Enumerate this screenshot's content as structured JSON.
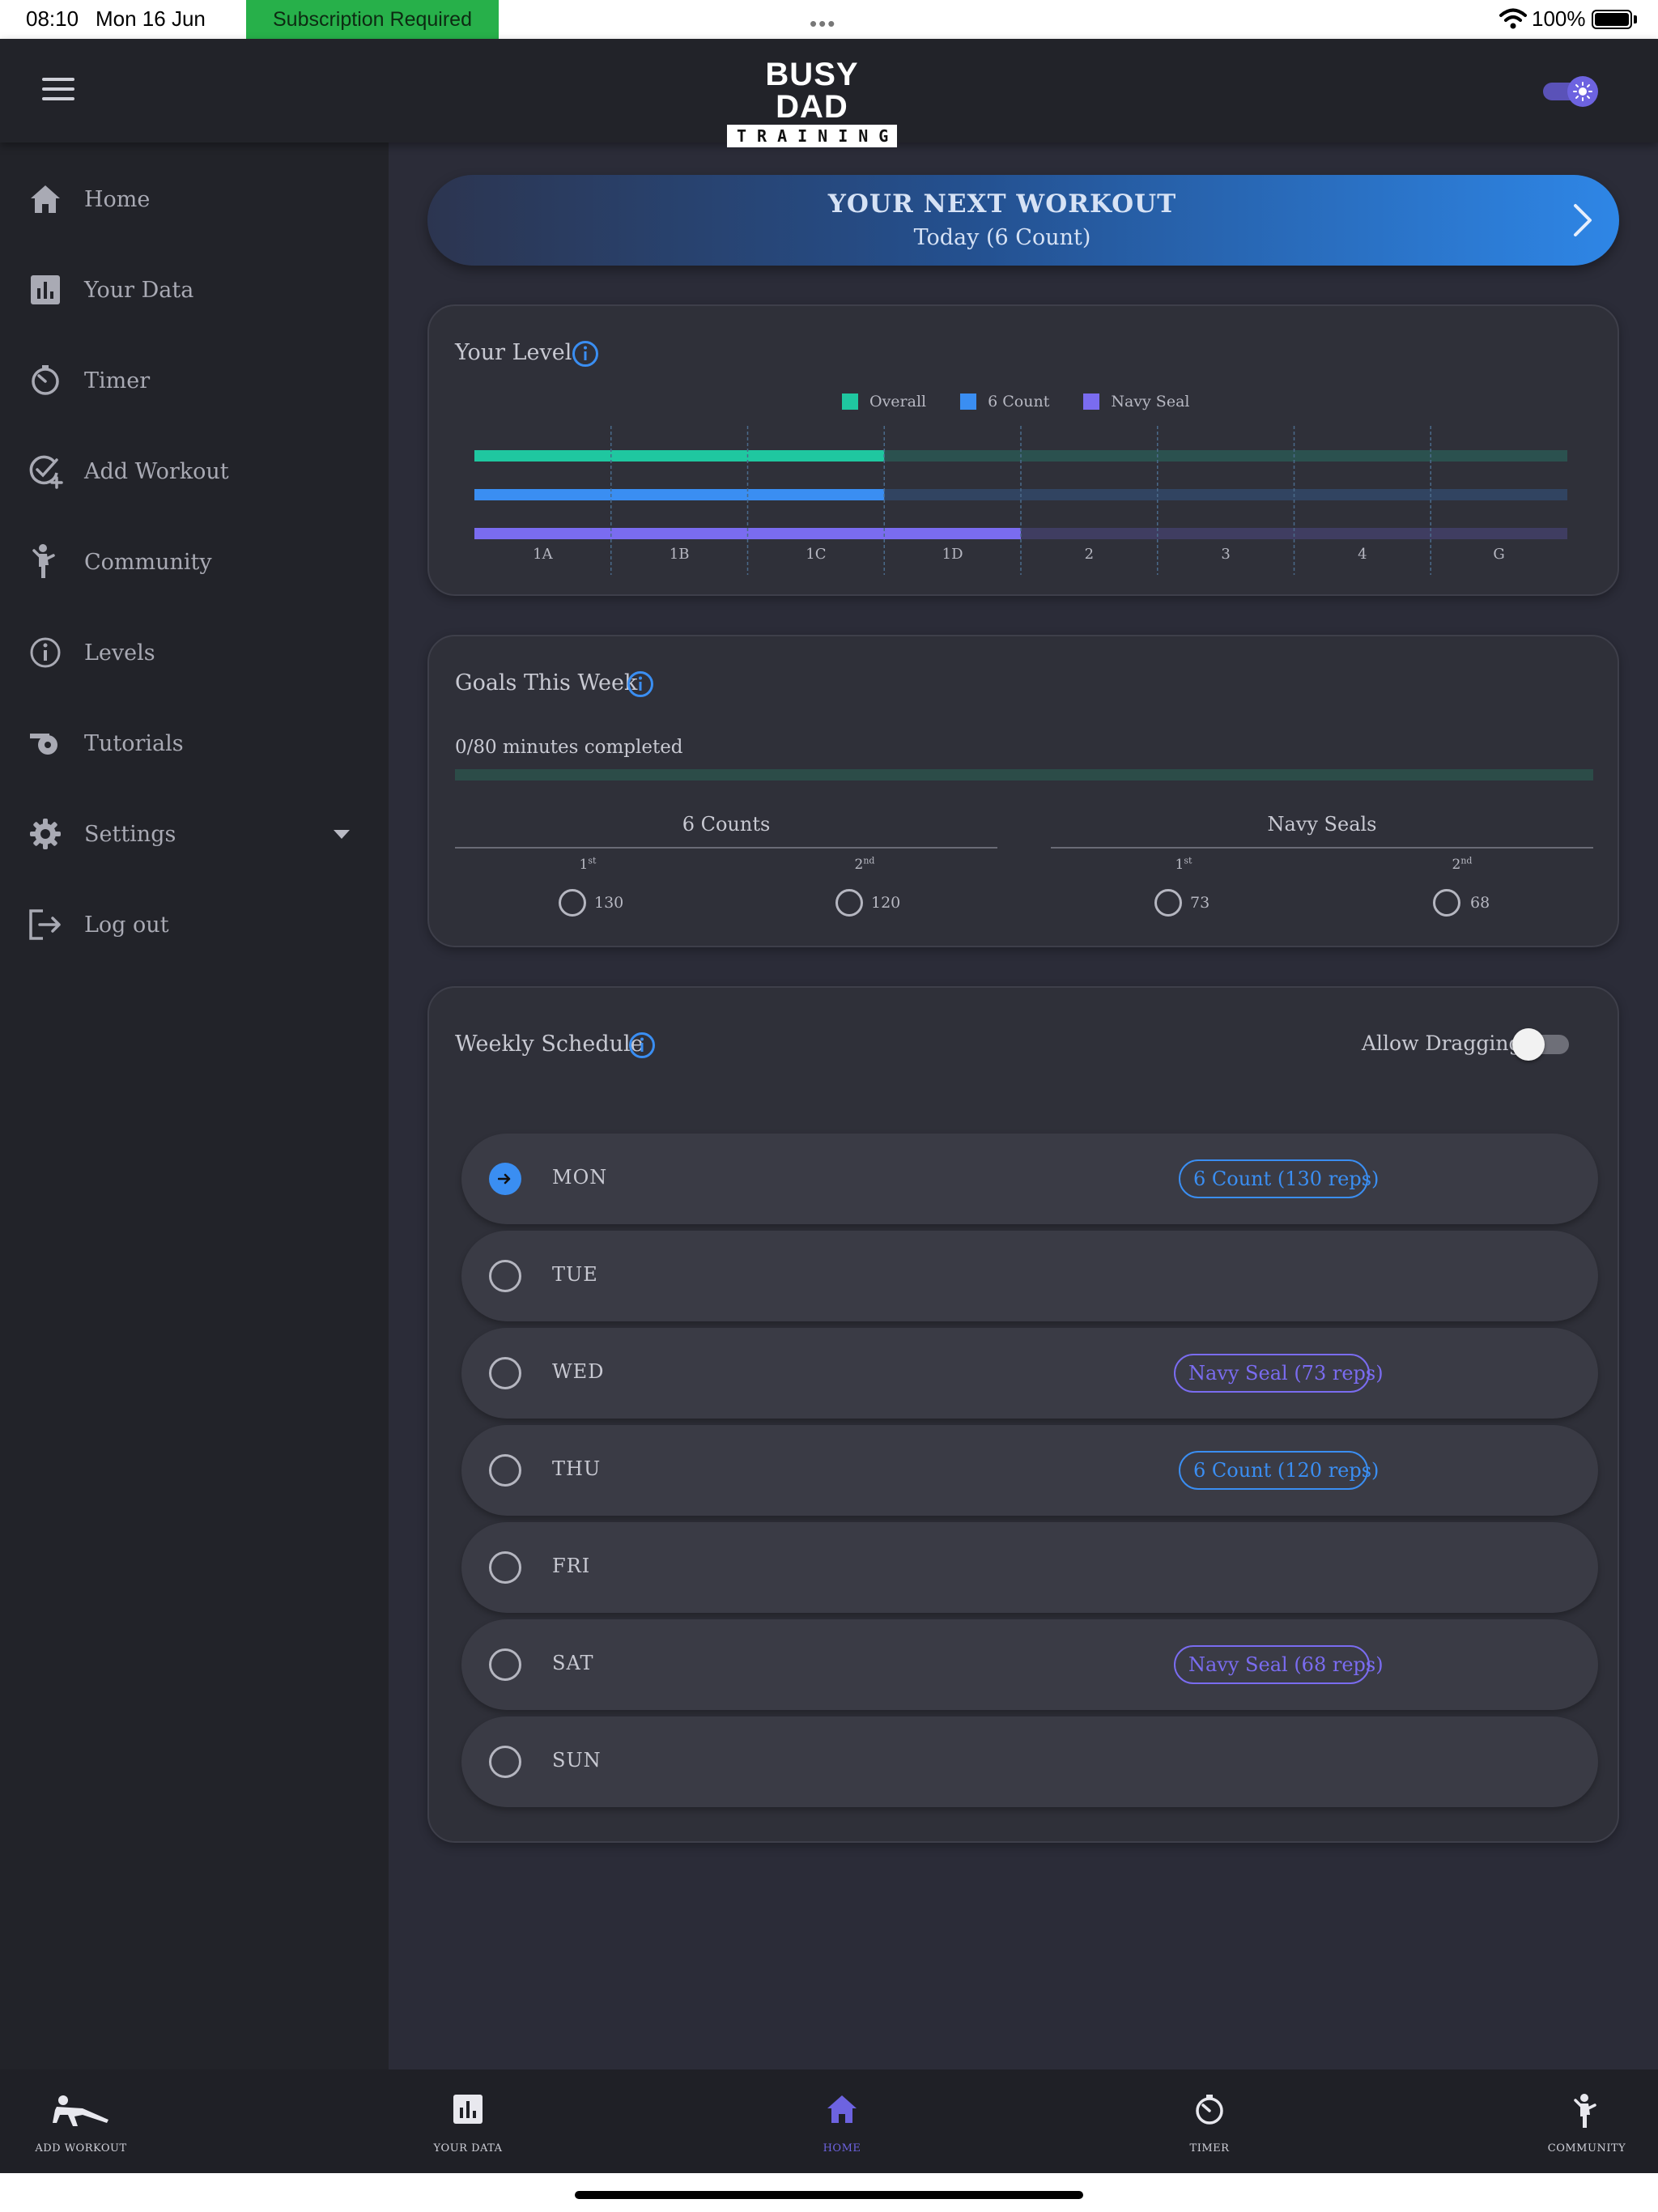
{
  "status_bar": {
    "time": "08:10",
    "date": "Mon 16 Jun",
    "subscription_banner": "Subscription Required",
    "more": "•••",
    "battery": "100%"
  },
  "header": {
    "logo_top": "BUSY DAD",
    "logo_bottom": "TRAINING",
    "theme_toggle": "on"
  },
  "sidebar": {
    "items": [
      {
        "label": "Home",
        "icon": "home-icon"
      },
      {
        "label": "Your Data",
        "icon": "bar-chart-icon"
      },
      {
        "label": "Timer",
        "icon": "timer-icon"
      },
      {
        "label": "Add Workout",
        "icon": "add-workout-icon"
      },
      {
        "label": "Community",
        "icon": "community-icon"
      },
      {
        "label": "Levels",
        "icon": "info-icon"
      },
      {
        "label": "Tutorials",
        "icon": "whistle-icon"
      },
      {
        "label": "Settings",
        "icon": "gear-icon"
      },
      {
        "label": "Log out",
        "icon": "logout-icon"
      }
    ]
  },
  "next_workout": {
    "title": "YOUR NEXT WORKOUT",
    "subtitle": "Today (6 Count)"
  },
  "level_card": {
    "title": "Your Level"
  },
  "goals_card": {
    "title": "Goals This Week",
    "progress_text": "0/80 minutes completed",
    "progress_fraction": 0,
    "groups": [
      {
        "title": "6 Counts",
        "items": [
          {
            "ordinal": "1",
            "suffix": "st",
            "value": "130"
          },
          {
            "ordinal": "2",
            "suffix": "nd",
            "value": "120"
          }
        ]
      },
      {
        "title": "Navy Seals",
        "items": [
          {
            "ordinal": "1",
            "suffix": "st",
            "value": "73"
          },
          {
            "ordinal": "2",
            "suffix": "nd",
            "value": "68"
          }
        ]
      }
    ]
  },
  "schedule_card": {
    "title": "Weekly Schedule",
    "drag_label": "Allow Dragging",
    "drag_enabled": false,
    "days": [
      {
        "day": "MON",
        "active": true,
        "chip": "6 Count (130 reps)",
        "chip_color": "blue"
      },
      {
        "day": "TUE",
        "active": false,
        "chip": "",
        "chip_color": ""
      },
      {
        "day": "WED",
        "active": false,
        "chip": "Navy Seal (73 reps)",
        "chip_color": "purple"
      },
      {
        "day": "THU",
        "active": false,
        "chip": "6 Count (120 reps)",
        "chip_color": "blue"
      },
      {
        "day": "FRI",
        "active": false,
        "chip": "",
        "chip_color": ""
      },
      {
        "day": "SAT",
        "active": false,
        "chip": "Navy Seal (68 reps)",
        "chip_color": "purple"
      },
      {
        "day": "SUN",
        "active": false,
        "chip": "",
        "chip_color": ""
      }
    ]
  },
  "tabbar": {
    "tabs": [
      {
        "label": "ADD WORKOUT",
        "icon": "pushup-icon",
        "active": false
      },
      {
        "label": "YOUR DATA",
        "icon": "bar-chart-icon",
        "active": false
      },
      {
        "label": "HOME",
        "icon": "home-icon",
        "active": true
      },
      {
        "label": "TIMER",
        "icon": "timer-icon",
        "active": false
      },
      {
        "label": "COMMUNITY",
        "icon": "community-icon",
        "active": false
      }
    ]
  },
  "colors": {
    "overall": "#1fc7a0",
    "six_count": "#3a8ef2",
    "navy_seal": "#7a6cf0",
    "accent_purple": "#6d63e0"
  },
  "chart_data": {
    "type": "bar",
    "orientation": "horizontal",
    "categories": [
      "1A",
      "1B",
      "1C",
      "1D",
      "2",
      "3",
      "4",
      "G"
    ],
    "series": [
      {
        "name": "Overall",
        "value": 3,
        "color": "#1fc7a0"
      },
      {
        "name": "6 Count",
        "value": 3,
        "color": "#3a8ef2"
      },
      {
        "name": "Navy Seal",
        "value": 4,
        "color": "#7a6cf0"
      }
    ],
    "xlim": [
      0,
      8
    ],
    "legend": "top",
    "grid": true
  }
}
